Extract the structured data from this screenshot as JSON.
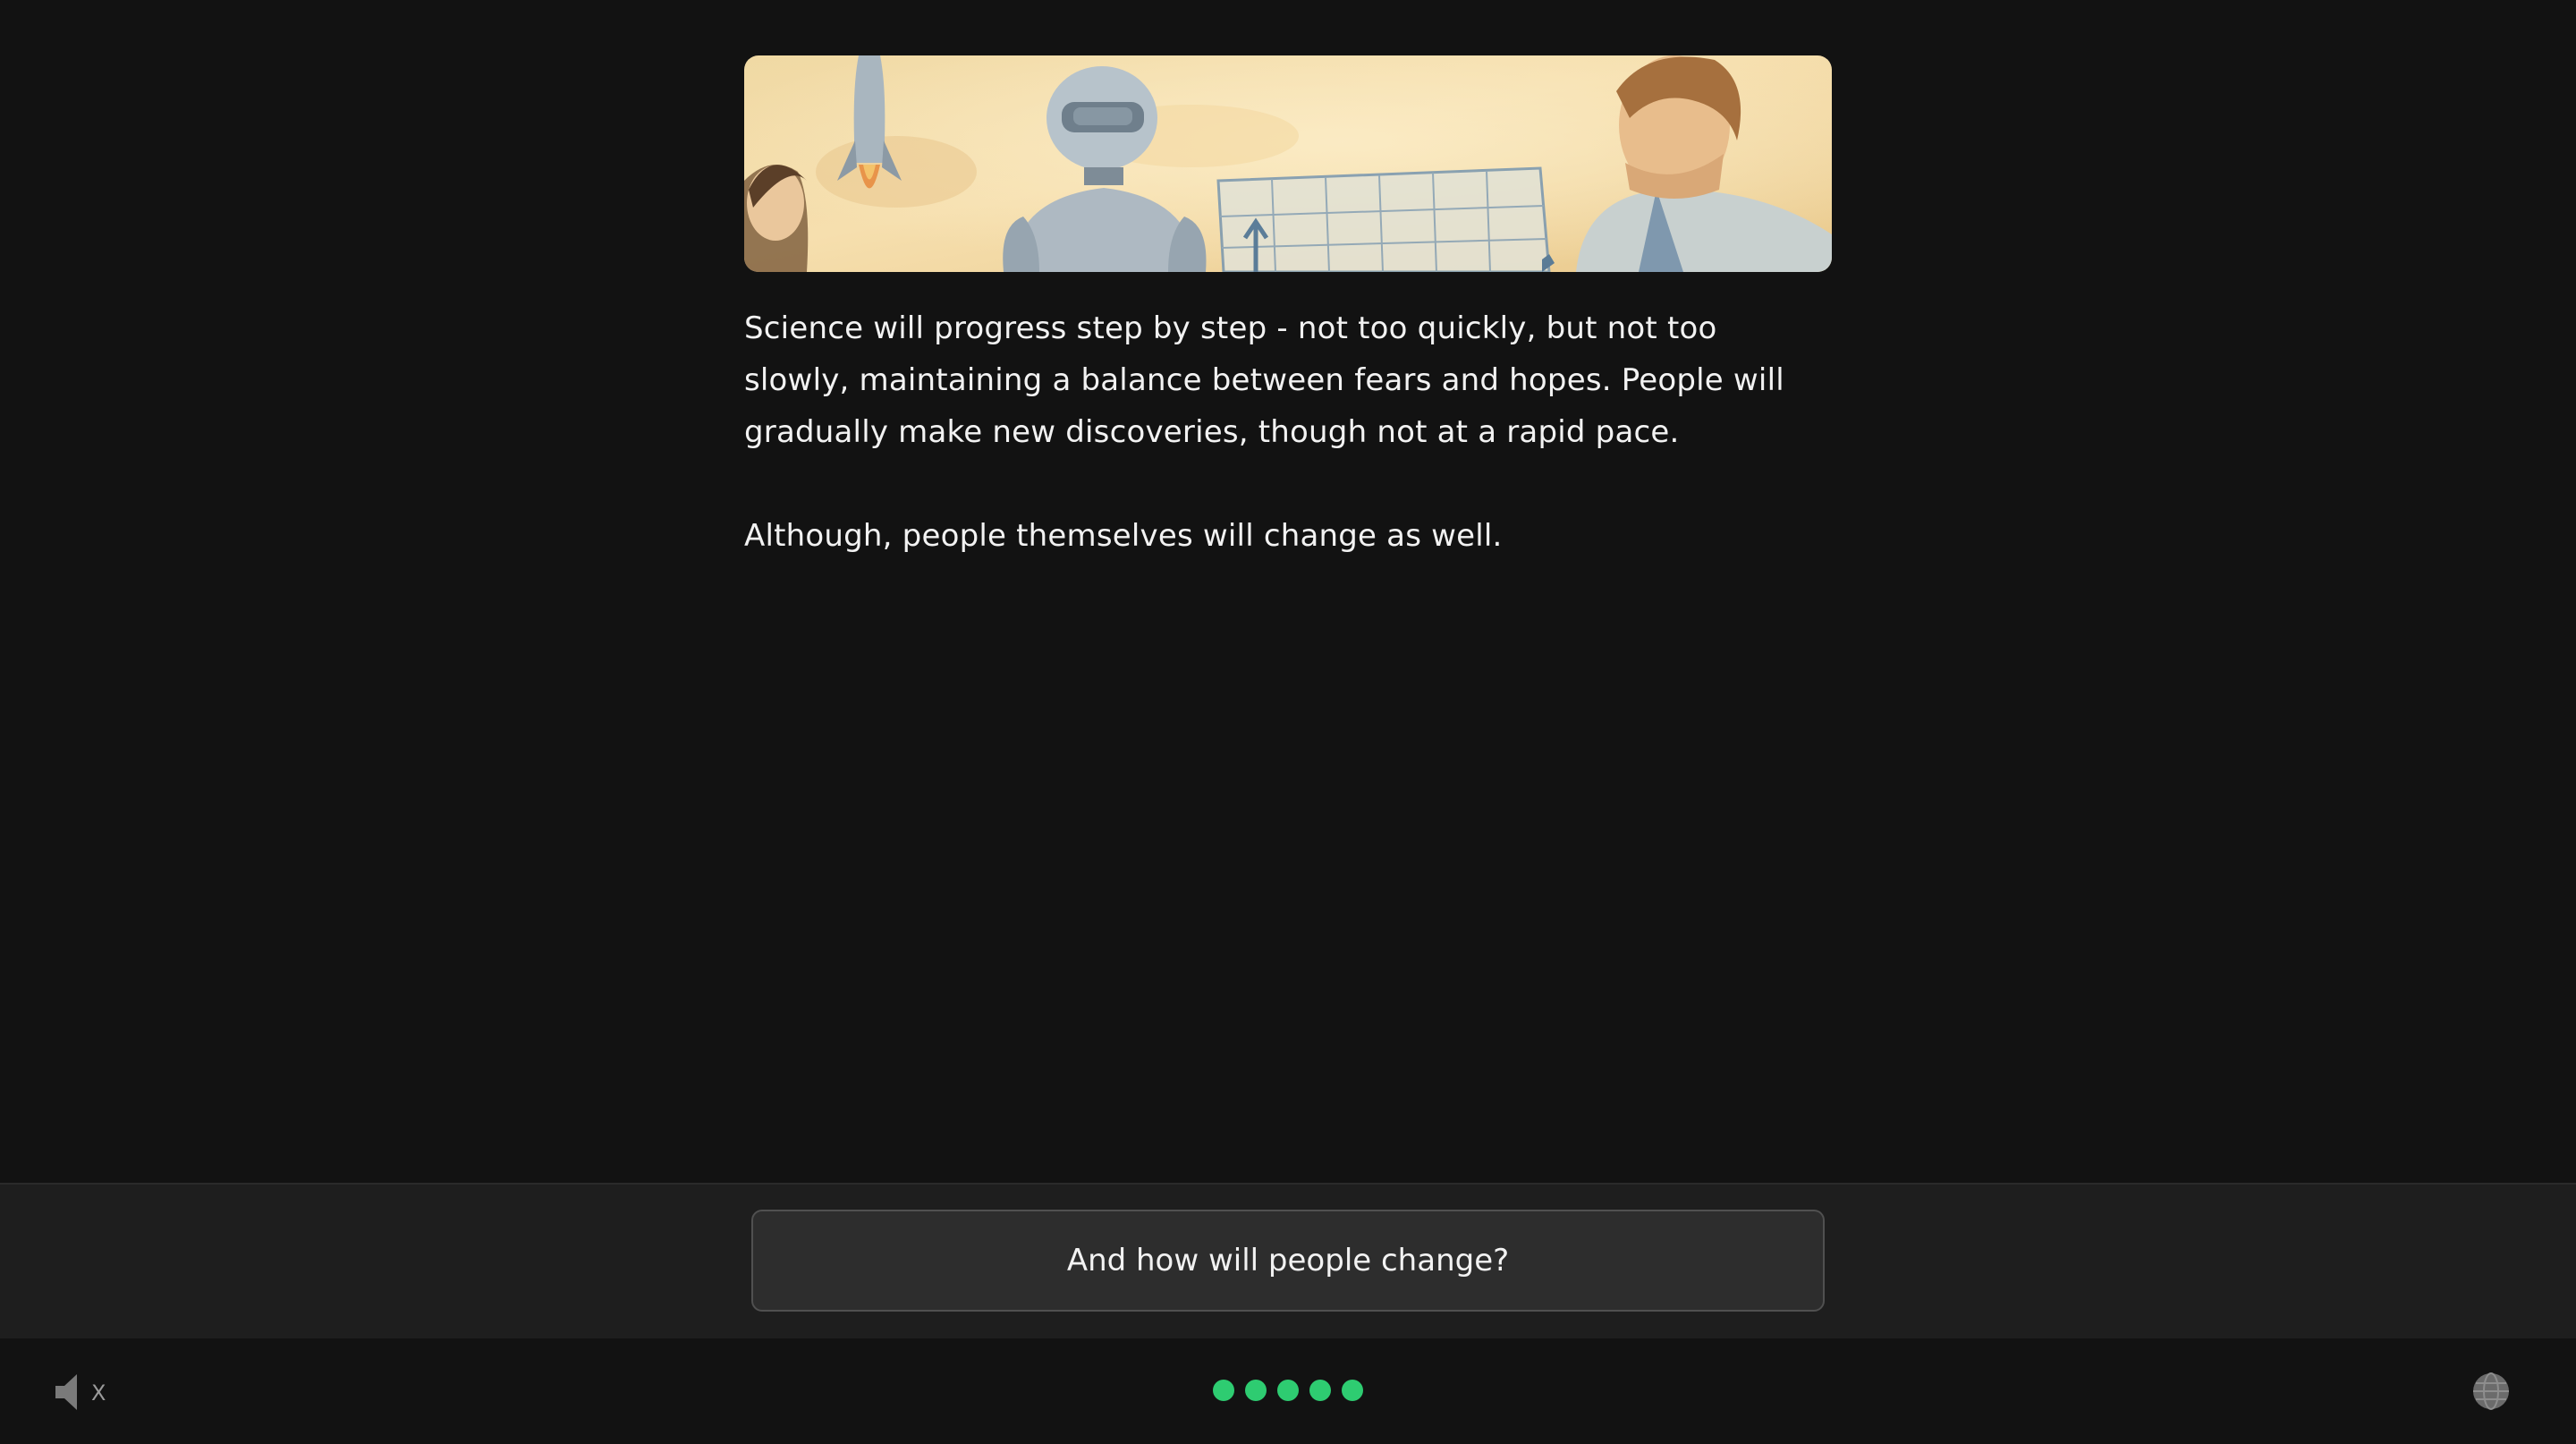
{
  "banner": {
    "icon": "illustration-people-robot-rocket-chart"
  },
  "story": {
    "paragraphs": [
      "Science will progress step by step - not too quickly, but not too slowly, maintaining a balance between fears and hopes. People will gradually make new discoveries, though not at a rapid pace.",
      "Although, people themselves will change as well."
    ]
  },
  "choices": [
    {
      "label": "And how will people change?"
    }
  ],
  "footer": {
    "sound_icon": "speaker-muted-icon",
    "sound_mark": "X",
    "progress": {
      "current": 5,
      "total": 5,
      "color": "#2ecc71"
    },
    "language_icon": "globe-icon"
  },
  "colors": {
    "background": "#121212",
    "panel": "#1e1e1e",
    "accent": "#2ecc71",
    "text": "#f2f2f2"
  }
}
